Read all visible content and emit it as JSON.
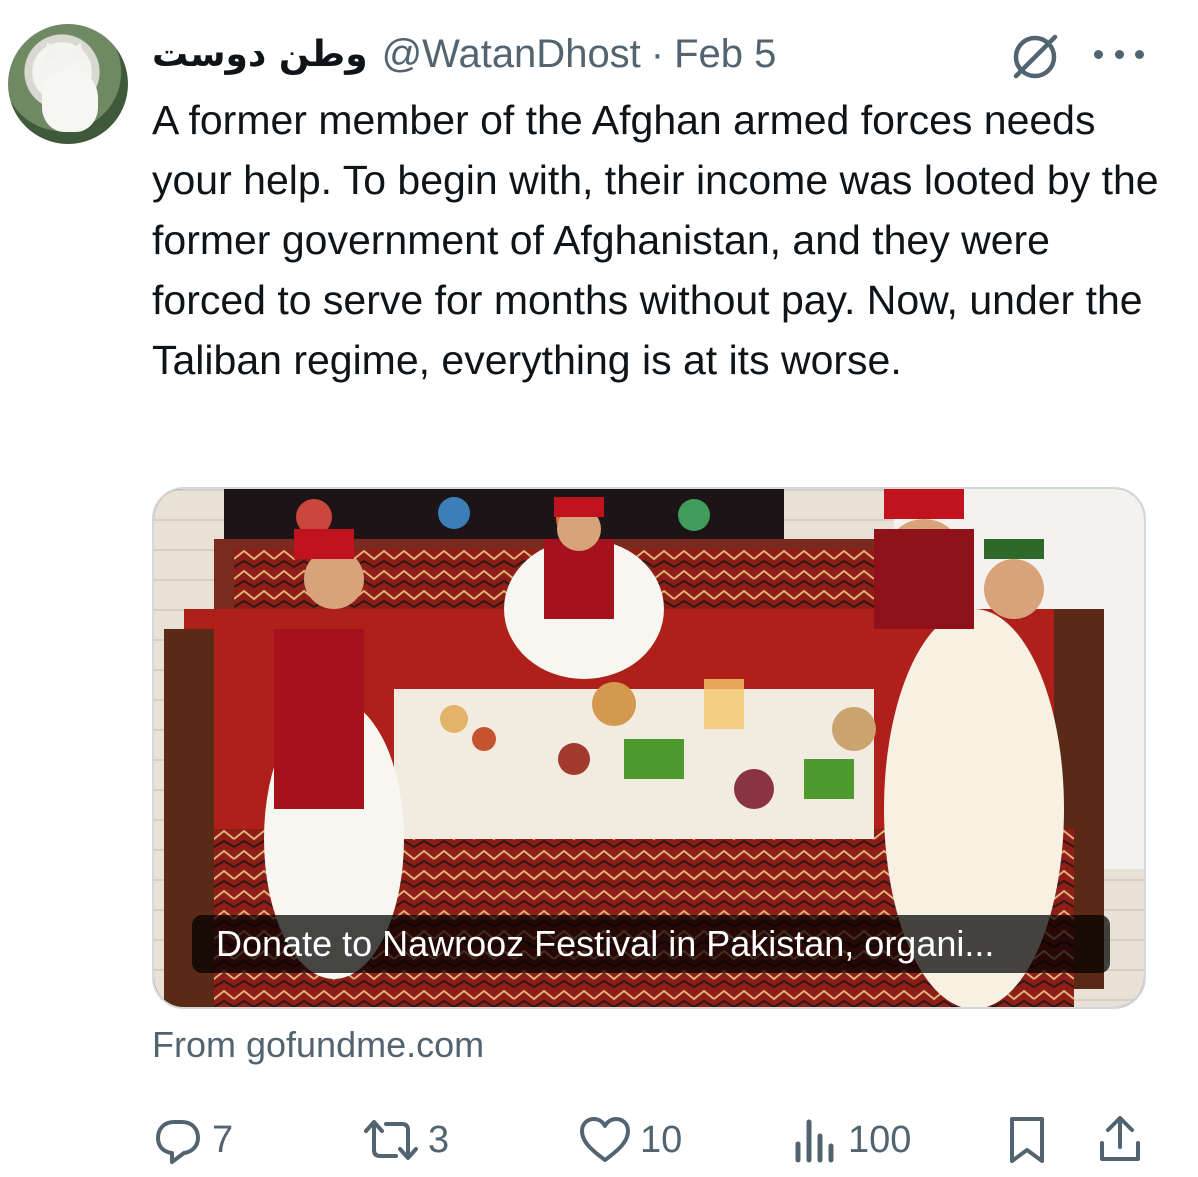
{
  "author": {
    "display_name": "وطن دوست",
    "handle": "@WatanDhost",
    "separator": "·",
    "date": "Feb 5"
  },
  "tweet": {
    "text": "A former member of the Afghan armed forces needs your help. To begin with, their income was looted by the former government of Afghanistan, and they were forced to serve for months without pay. Now, under the Taliban regime, everything is at its worse."
  },
  "card": {
    "title": "Donate to Nawrooz Festival in Pakistan, organi...",
    "source": "From gofundme.com"
  },
  "actions": {
    "replies": "7",
    "reposts": "3",
    "likes": "10",
    "views": "100"
  },
  "icons": {
    "grok": "grok-icon",
    "more": "more-icon",
    "reply": "reply-icon",
    "repost": "repost-icon",
    "like": "heart-icon",
    "views": "views-icon",
    "bookmark": "bookmark-icon",
    "share": "share-icon"
  },
  "colors": {
    "text_primary": "#0f1419",
    "text_secondary": "#536471",
    "card_border": "#cfd9de"
  }
}
